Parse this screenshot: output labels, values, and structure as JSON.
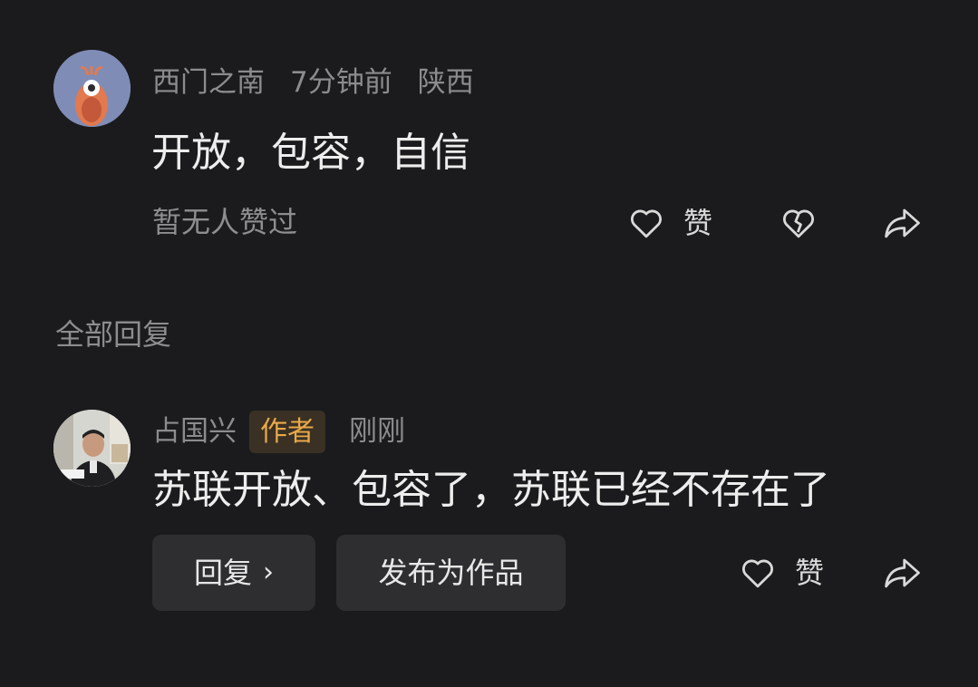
{
  "top_comment": {
    "username": "西门之南",
    "time": "7分钟前",
    "location": "陕西",
    "text": "开放，包容，自信",
    "likes_status": "暂无人赞过",
    "like_label": "赞",
    "like_icon": "heart-outline-icon",
    "dislike_icon": "broken-heart-icon",
    "share_icon": "share-arrow-icon"
  },
  "section": {
    "all_replies_label": "全部回复"
  },
  "reply": {
    "username": "占国兴",
    "badge": "作者",
    "time": "刚刚",
    "text": "苏联开放、包容了，苏联已经不存在了",
    "reply_button": "回复",
    "reply_chevron": "›",
    "publish_button": "发布为作品",
    "like_label": "赞",
    "like_icon": "heart-outline-icon",
    "share_icon": "share-arrow-icon"
  },
  "colors": {
    "background": "#1b1b1d",
    "badge_text": "#e9a94a",
    "badge_bg": "#3a3124",
    "button_bg": "#2e2e31"
  }
}
